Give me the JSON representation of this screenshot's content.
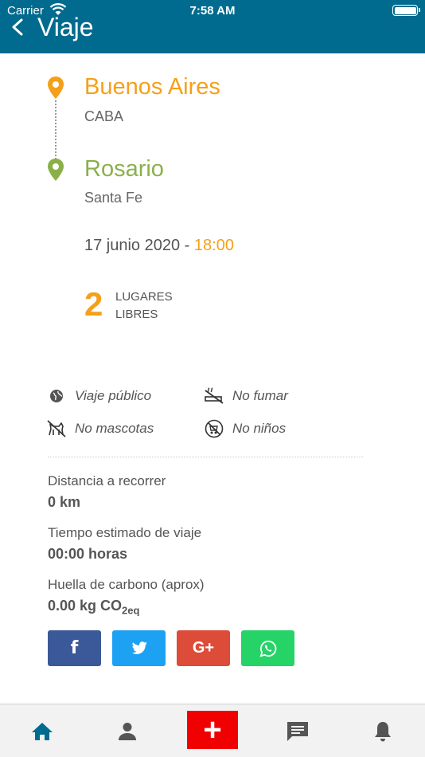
{
  "status_bar": {
    "carrier": "Carrier",
    "time": "7:58 AM"
  },
  "header": {
    "title": "Viaje"
  },
  "origin": {
    "city": "Buenos Aires",
    "province": "CABA"
  },
  "destination": {
    "city": "Rosario",
    "province": "Santa Fe"
  },
  "trip": {
    "date": "17 junio 2020 - ",
    "time": "18:00",
    "seats": "2",
    "seats_label_1": "LUGARES",
    "seats_label_2": "LIBRES"
  },
  "features": [
    {
      "label": "Viaje público",
      "icon": "globe-icon"
    },
    {
      "label": "No fumar",
      "icon": "no-smoking-icon"
    },
    {
      "label": "No mascotas",
      "icon": "no-pets-icon"
    },
    {
      "label": "No niños",
      "icon": "no-children-icon"
    }
  ],
  "info": {
    "distance_label": "Distancia a recorrer",
    "distance_value": "0 km",
    "time_label": "Tiempo estimado de viaje",
    "time_value": "00:00 horas",
    "carbon_label": "Huella de carbono (aprox)",
    "carbon_value": "0.00 kg CO",
    "carbon_sub": "2eq"
  },
  "share": {
    "facebook": {
      "label": "f",
      "color": "#3b5998"
    },
    "twitter": {
      "label": "twitter",
      "color": "#1da1f2"
    },
    "gplus": {
      "label": "G+",
      "color": "#dd4b39"
    },
    "whatsapp": {
      "label": "whatsapp",
      "color": "#25d366"
    }
  },
  "colors": {
    "primary": "#006b8f",
    "accent": "#f5a01a",
    "green": "#8bb04a",
    "plus": "#f00000"
  },
  "tabs": [
    {
      "icon": "home-icon"
    },
    {
      "icon": "person-icon"
    },
    {
      "icon": "plus-icon",
      "label": "+"
    },
    {
      "icon": "chat-icon"
    },
    {
      "icon": "bell-icon"
    }
  ]
}
